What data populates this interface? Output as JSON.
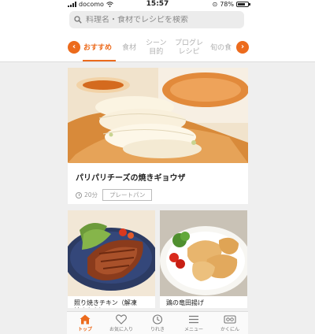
{
  "status": {
    "carrier": "docomo",
    "time": "15:57",
    "battery": "78%"
  },
  "search": {
    "placeholder": "料理名・食材でレシピを検索"
  },
  "tabs": [
    {
      "label": "おすすめ",
      "active": true
    },
    {
      "label": "食材"
    },
    {
      "label": "シーン\n目的"
    },
    {
      "label": "プログレ\nレシピ"
    },
    {
      "label": "旬の食"
    }
  ],
  "featured": {
    "title": "パリパリチーズの焼きギョウザ",
    "time": "20分",
    "tag": "プレートパン"
  },
  "recipes": [
    {
      "title": "照り焼きチキン（解凍\n焼きもも）"
    },
    {
      "title": "鶏の竜田揚げ"
    }
  ],
  "bottom_nav": [
    {
      "label": "トップ",
      "icon": "home-icon",
      "active": true
    },
    {
      "label": "お気に入り",
      "icon": "heart-icon"
    },
    {
      "label": "りれき",
      "icon": "history-icon"
    },
    {
      "label": "メニュー",
      "icon": "menu-icon"
    },
    {
      "label": "かくにん",
      "icon": "device-icon"
    }
  ],
  "colors": {
    "accent": "#ec6b1d"
  }
}
